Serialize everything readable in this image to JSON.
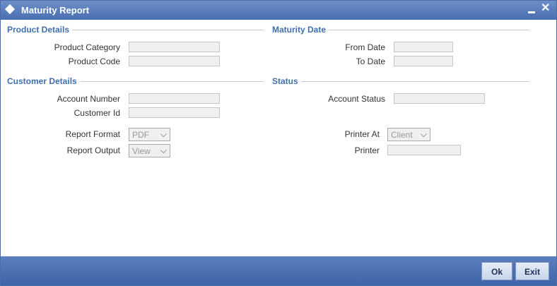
{
  "window": {
    "title": "Maturity Report"
  },
  "sections": {
    "product_details": "Product Details",
    "maturity_date": "Maturity Date",
    "customer_details": "Customer Details",
    "status": "Status"
  },
  "fields": {
    "product_category": {
      "label": "Product Category",
      "value": ""
    },
    "product_code": {
      "label": "Product Code",
      "value": ""
    },
    "from_date": {
      "label": "From Date",
      "value": ""
    },
    "to_date": {
      "label": "To Date",
      "value": ""
    },
    "account_number": {
      "label": "Account Number",
      "value": ""
    },
    "customer_id": {
      "label": "Customer Id",
      "value": ""
    },
    "account_status": {
      "label": "Account Status",
      "value": ""
    },
    "report_format": {
      "label": "Report Format",
      "value": "PDF"
    },
    "report_output": {
      "label": "Report Output",
      "value": "View"
    },
    "printer_at": {
      "label": "Printer At",
      "value": "Client"
    },
    "printer": {
      "label": "Printer",
      "value": ""
    }
  },
  "buttons": {
    "ok": "Ok",
    "exit": "Exit"
  },
  "colors": {
    "accent": "#3f6fae",
    "titlebar": "#5a7fc0",
    "footer": "#4a6fb1"
  },
  "icons": {
    "title": "diamond-icon",
    "minimize": "minimize-icon",
    "close": "close-icon",
    "dropdown": "chevron-down-icon"
  }
}
